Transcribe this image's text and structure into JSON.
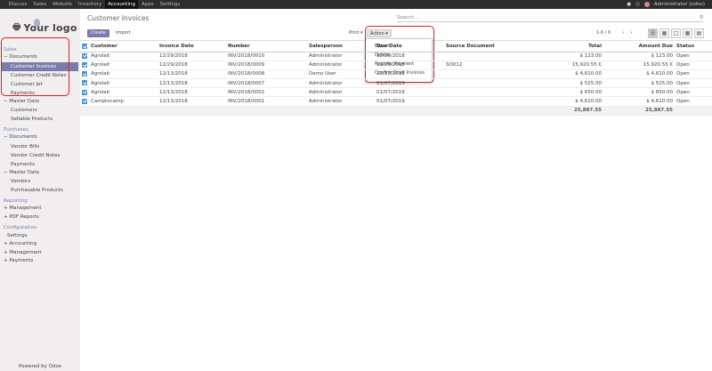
{
  "topbar": {
    "menu": [
      "Discuss",
      "Sales",
      "Website",
      "Inventory",
      "Accounting",
      "Apps",
      "Settings"
    ],
    "active_index": 4,
    "user": "Administrator (odoo)"
  },
  "logo": {
    "mark": "ɠ",
    "text": "Your logo"
  },
  "sidebar": {
    "sales_section": "Sales",
    "sales_documents": "Documents",
    "sales_docs": [
      "Customer Invoices",
      "Customer Credit Notes",
      "Customer Jet",
      "Payments"
    ],
    "sales_master": "Master Data",
    "sales_master_items": [
      "Customers",
      "Sellable Products"
    ],
    "purchases_section": "Purchases",
    "purch_documents": "Documents",
    "purch_docs": [
      "Vendor Bills",
      "Vendor Credit Notes",
      "Payments"
    ],
    "purch_master": "Master Data",
    "purch_master_items": [
      "Vendors",
      "Purchasable Products"
    ],
    "reporting_section": "Reporting",
    "reporting_items": [
      "Management",
      "PDF Reports"
    ],
    "config_section": "Configuration",
    "config_settings": "Settings",
    "config_items": [
      "Accounting",
      "Management",
      "Payments"
    ],
    "powered_by": "Powered by Odoo"
  },
  "control": {
    "title": "Customer Invoices",
    "search_placeholder": "Search...",
    "create": "Create",
    "import": "Import",
    "print": "Print",
    "action": "Action",
    "action_menu": [
      "Export",
      "Delete",
      "Register Payment",
      "Confirm Draft Invoices"
    ],
    "pager": "1-6 / 6"
  },
  "table": {
    "headers": [
      "Customer",
      "Invoice Date",
      "Number",
      "Salesperson",
      "Due Date",
      "Source Document",
      "Total",
      "Amount Due",
      "Status"
    ],
    "rows": [
      [
        "Agrolait",
        "12/29/2018",
        "INV/2018/0010",
        "Administrator",
        "12/29/2018",
        "",
        "$ 123.00",
        "$ 123.00",
        "Open"
      ],
      [
        "Agrolait",
        "12/29/2018",
        "INV/2018/0009",
        "Administrator",
        "12/29/2018",
        "SO012",
        "15,920.55 €",
        "15,920.55 €",
        "Open"
      ],
      [
        "Agrolait",
        "12/13/2018",
        "INV/2018/0008",
        "Demo User",
        "12/13/2018",
        "",
        "$ 4,610.00",
        "$ 4,610.00",
        "Open"
      ],
      [
        "Agrolait",
        "12/13/2018",
        "INV/2018/0007",
        "Administrator",
        "01/07/2019",
        "",
        "$ 525.00",
        "$ 525.00",
        "Open"
      ],
      [
        "Agrolait",
        "12/13/2018",
        "INV/2018/0002",
        "Administrator",
        "01/07/2019",
        "",
        "$ 650.00",
        "$ 650.00",
        "Open"
      ],
      [
        "Camptocamp",
        "12/13/2018",
        "INV/2018/0001",
        "Administrator",
        "01/07/2019",
        "",
        "$ 4,610.00",
        "$ 4,610.00",
        "Open"
      ]
    ],
    "total": "25,887.55",
    "amount_due_total": "25,887.55"
  },
  "colors": {
    "accent": "#7c7bad",
    "topbar": "#2d2d2d",
    "highlight": "#e02020",
    "checkbox": "#4a8fd1"
  }
}
